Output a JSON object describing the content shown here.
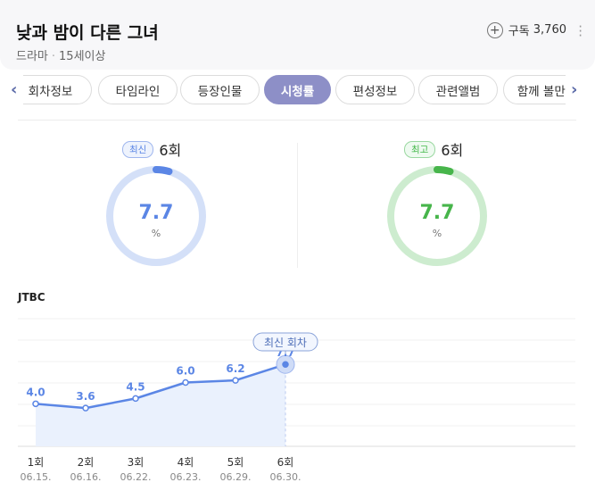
{
  "header": {
    "title": "낮과 밤이 다른 그녀",
    "genre": "드라마",
    "rating": "15세이상",
    "subscribe_label": "구독",
    "subscribe_count": "3,760"
  },
  "tabs": [
    {
      "label": "회차정보",
      "active": false
    },
    {
      "label": "타임라인",
      "active": false
    },
    {
      "label": "등장인물",
      "active": false
    },
    {
      "label": "시청률",
      "active": true
    },
    {
      "label": "편성정보",
      "active": false
    },
    {
      "label": "관련앨범",
      "active": false
    },
    {
      "label": "함께 볼만한",
      "active": false
    }
  ],
  "latest": {
    "badge": "최신",
    "episode": "6회",
    "value": "7.7",
    "unit": "%",
    "color": "#5b86e5",
    "track": "#d4e0f8"
  },
  "highest": {
    "badge": "최고",
    "episode": "6회",
    "value": "7.7",
    "unit": "%",
    "color": "#47b54b",
    "track": "#cdeccf"
  },
  "chart": {
    "channel": "JTBC",
    "callout": "최신 회차",
    "line_color": "#5b86e5"
  },
  "chart_data": {
    "type": "line",
    "categories": [
      "1회",
      "2회",
      "3회",
      "4회",
      "5회",
      "6회"
    ],
    "dates": [
      "06.15.",
      "06.16.",
      "06.22.",
      "06.23.",
      "06.29.",
      "06.30."
    ],
    "values": [
      4.0,
      3.6,
      4.5,
      6.0,
      6.2,
      7.7
    ],
    "ylim": [
      0,
      12
    ]
  }
}
